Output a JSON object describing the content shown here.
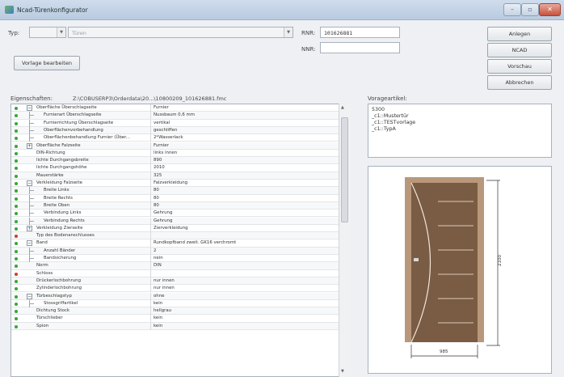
{
  "window": {
    "title": "Ncad-Türenkonfigurator",
    "controls": [
      "minimize-icon",
      "maximize-icon",
      "close-icon"
    ]
  },
  "top": {
    "typ_label": "Typ:",
    "typ_value": "",
    "type_combo_value": "Türen",
    "rnr_label": "RNR:",
    "rnr_value": "101626881",
    "nnr_label": "NNR:",
    "nnr_value": "",
    "edit_template_label": "Vorlage bearbeiten"
  },
  "buttons": {
    "anlegen": "Anlegen",
    "ncad": "NCAD",
    "vorschau": "Vorschau",
    "abbrechen": "Abbrechen"
  },
  "properties": {
    "label": "Eigenschaften:",
    "path": "Z:\\COBUSERP3\\Orderdata\\20...\\10800209_101626881.fmc",
    "rows": [
      {
        "name": "Oberfläche Überschlagseite",
        "value": "Furnier",
        "level": 0,
        "exp": "minus",
        "dot": "green"
      },
      {
        "name": "Furnierart Überschlagseite",
        "value": "Nussbaum 0,6 mm",
        "level": 1,
        "dot": "green"
      },
      {
        "name": "Furnierrichtung Überschlagseite",
        "value": "vertikal",
        "level": 1,
        "dot": "green"
      },
      {
        "name": "Oberflächenvorbehandlung",
        "value": "geschliffen",
        "level": 1,
        "dot": "green"
      },
      {
        "name": "Oberflächenbehandlung Furnier (Über...",
        "value": "2*Wasserlack",
        "level": 1,
        "dot": "green"
      },
      {
        "name": "Oberfläche Falzseite",
        "value": "Furnier",
        "level": 0,
        "exp": "plus",
        "dot": "green"
      },
      {
        "name": "DIN-Richtung",
        "value": "links innen",
        "level": 0,
        "dot": "green"
      },
      {
        "name": "lichte Durchgangsbreite",
        "value": "890",
        "level": 0,
        "dot": "green"
      },
      {
        "name": "lichte Durchgangshöhe",
        "value": "2010",
        "level": 0,
        "dot": "green"
      },
      {
        "name": "Mauerstärke",
        "value": "325",
        "level": 0,
        "dot": "green"
      },
      {
        "name": "Verkleidung Falzseite",
        "value": "Falzverkleidung",
        "level": 0,
        "exp": "minus",
        "dot": "green"
      },
      {
        "name": "Breite Links",
        "value": "80",
        "level": 1,
        "dot": "green"
      },
      {
        "name": "Breite Rechts",
        "value": "80",
        "level": 1,
        "dot": "green"
      },
      {
        "name": "Breite Oben",
        "value": "80",
        "level": 1,
        "dot": "green"
      },
      {
        "name": "Verbindung Links",
        "value": "Gehrung",
        "level": 1,
        "dot": "green"
      },
      {
        "name": "Verbindung Rechts",
        "value": "Gehrung",
        "level": 1,
        "dot": "green"
      },
      {
        "name": "Verkleidung Zierseite",
        "value": "Zierverkleidung",
        "level": 0,
        "exp": "plus",
        "dot": "green"
      },
      {
        "name": "Typ des Bodenanschlusses",
        "value": "",
        "level": 0,
        "dot": "red"
      },
      {
        "name": "Band",
        "value": "Rundkopfband zweit. GK16 verchromt",
        "level": 0,
        "exp": "minus",
        "dot": "green"
      },
      {
        "name": "Anzahl Bänder",
        "value": "2",
        "level": 1,
        "dot": "green"
      },
      {
        "name": "Bandsicherung",
        "value": "nein",
        "level": 1,
        "dot": "green"
      },
      {
        "name": "Norm",
        "value": "DIN",
        "level": 0,
        "dot": "green"
      },
      {
        "name": "Schloss",
        "value": "",
        "level": 0,
        "dot": "red"
      },
      {
        "name": "Drückerlochbohrung",
        "value": "nur innen",
        "level": 0,
        "dot": "green"
      },
      {
        "name": "Zylinderlochbohrung",
        "value": "nur innen",
        "level": 0,
        "dot": "green"
      },
      {
        "name": "Türbeschlagstyp",
        "value": "ohne",
        "level": 0,
        "exp": "minus",
        "dot": "green"
      },
      {
        "name": "Stossgriffartikel",
        "value": "kein",
        "level": 1,
        "dot": "green"
      },
      {
        "name": "Dichtung Stock",
        "value": "hellgrau",
        "level": 0,
        "dot": "green"
      },
      {
        "name": "Türschlieber",
        "value": "kein",
        "level": 0,
        "dot": "green"
      },
      {
        "name": "Spion",
        "value": "kein",
        "level": 0,
        "dot": "green"
      }
    ]
  },
  "templates": {
    "label": "Vorageartikel:",
    "items": [
      "5300",
      "_c1::Mustertür",
      "_c1::TESTvorlage",
      "_c1::TypA"
    ]
  },
  "preview": {
    "dim_height": "2100",
    "dim_width": "985",
    "door_color": "#7a5c45",
    "frame_color": "#b9977a"
  },
  "colors": {
    "ok_dot": "#3aa43a",
    "error_dot": "#d23b2a"
  }
}
